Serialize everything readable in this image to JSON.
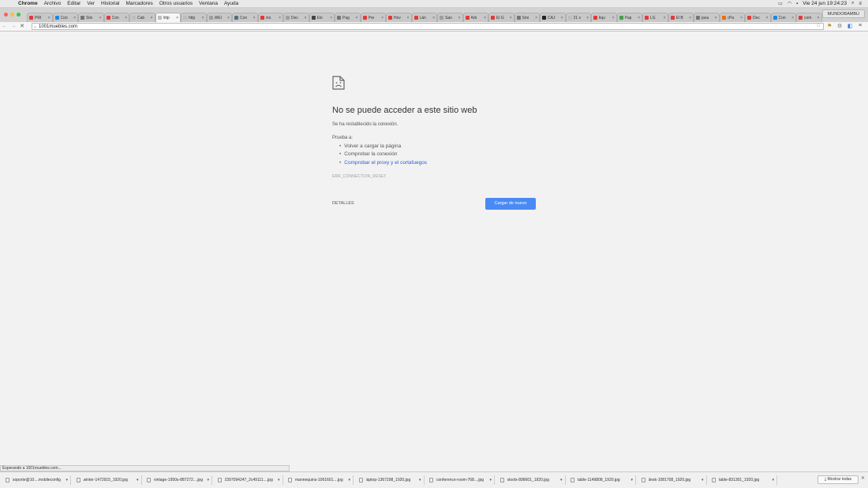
{
  "menubar": {
    "app": "Chrome",
    "items": [
      "Archivo",
      "Editar",
      "Ver",
      "Historial",
      "Marcadores",
      "Otros usuarios",
      "Ventana",
      "Ayuda"
    ],
    "clock": "Vie 24 jun  19:24:23"
  },
  "tabs": [
    {
      "title": "PRI",
      "color": "#e53935"
    },
    {
      "title": "Con",
      "color": "#1e88e5"
    },
    {
      "title": "Silo",
      "color": "#757575"
    },
    {
      "title": "Con",
      "color": "#e53935"
    },
    {
      "title": "Cab",
      "color": "#bdbdbd"
    },
    {
      "title": "http",
      "color": "#bdbdbd",
      "active": true
    },
    {
      "title": "http",
      "color": "#bdbdbd"
    },
    {
      "title": "WEI",
      "color": "#9e9e9e"
    },
    {
      "title": "Con",
      "color": "#546e7a"
    },
    {
      "title": "mo",
      "color": "#e53935"
    },
    {
      "title": "Dec",
      "color": "#9e9e9e"
    },
    {
      "title": "Elo",
      "color": "#424242"
    },
    {
      "title": "Pag",
      "color": "#757575"
    },
    {
      "title": "Pre",
      "color": "#e53935"
    },
    {
      "title": "Hov",
      "color": "#e53935"
    },
    {
      "title": "Lán",
      "color": "#e53935"
    },
    {
      "title": "San",
      "color": "#9e9e9e"
    },
    {
      "title": "Árb",
      "color": "#e53935"
    },
    {
      "title": "El G",
      "color": "#e53935"
    },
    {
      "title": "Smi",
      "color": "#757575"
    },
    {
      "title": "CAJ",
      "color": "#212121"
    },
    {
      "title": "21 x",
      "color": "#bdbdbd"
    },
    {
      "title": "liqu",
      "color": "#e53935"
    },
    {
      "title": "Pap",
      "color": "#43a047"
    },
    {
      "title": "LG",
      "color": "#e53935"
    },
    {
      "title": "El B",
      "color": "#e53935"
    },
    {
      "title": "java",
      "color": "#757575"
    },
    {
      "title": "cPa",
      "color": "#ef6c00"
    },
    {
      "title": "Dec",
      "color": "#e53935"
    },
    {
      "title": "Con",
      "color": "#1e88e5"
    },
    {
      "title": "com",
      "color": "#e53935"
    }
  ],
  "profile": "MUNDOBAMBU",
  "omnibox": {
    "url": "1001muebles.com"
  },
  "error": {
    "title": "No se puede acceder a este sitio web",
    "subtitle": "Se ha restablecido la conexión.",
    "try_label": "Prueba a:",
    "suggestions": [
      {
        "text": "Volver a cargar la página",
        "link": false
      },
      {
        "text": "Comprobar la conexión",
        "link": false
      },
      {
        "text": "Comprobar el proxy y el cortafuegos",
        "link": true
      }
    ],
    "code": "ERR_CONNECTION_RESET",
    "details_label": "DETALLES",
    "reload_label": "Cargar de nuevo"
  },
  "status_text": "Esperando a 1001muebles.com...",
  "downloads": [
    "soporte@10....mobileconfig",
    "winter-1472915_1920.jpg",
    "vintage-1950s-887272....jpg",
    "2397094247_2c49111....jpg",
    "mannequins-1061601....jpg",
    "laptop-1367298_1920.jpg",
    "conference-room-768....jpg",
    "stools-898601_1920.jpg",
    "table-1149808_1920.jpg",
    "desk-1081708_1920.jpg",
    "table-831301_1920.jpg"
  ],
  "show_all_label": "Mostrar todas",
  "colors": {
    "accent": "#4a8af4",
    "link": "#2a5bd7"
  }
}
